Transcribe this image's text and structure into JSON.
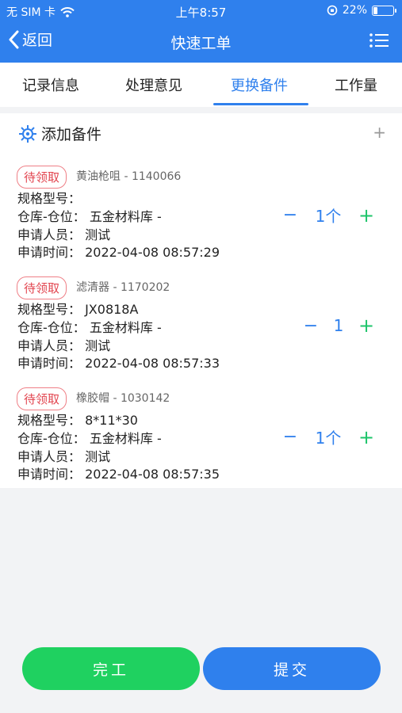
{
  "status_bar": {
    "carrier": "无 SIM 卡",
    "time": "上午8:57",
    "battery": "22%",
    "battery_level": 0.22
  },
  "nav": {
    "back_label": "返回",
    "title": "快速工单"
  },
  "tabs": [
    {
      "label": "记录信息",
      "active": false
    },
    {
      "label": "处理意见",
      "active": false
    },
    {
      "label": "更换备件",
      "active": true
    },
    {
      "label": "工作量",
      "active": false
    }
  ],
  "section": {
    "title": "添加备件",
    "add_symbol": "+"
  },
  "items": [
    {
      "status": "待领取",
      "title": "黄油枪咀 - 1140066",
      "spec": "规格型号：",
      "warehouse": "仓库-仓位：  五金材料库 -",
      "applicant": "申请人员：  测试",
      "time": "申请时间：  2022-04-08 08:57:29",
      "quantity": "1个"
    },
    {
      "status": "待领取",
      "title": "滤清器 - 1170202",
      "spec": "规格型号：  JX0818A",
      "warehouse": "仓库-仓位：  五金材料库 -",
      "applicant": "申请人员：  测试",
      "time": "申请时间：  2022-04-08 08:57:33",
      "quantity": "1"
    },
    {
      "status": "待领取",
      "title": "橡胶帽 - 1030142",
      "spec": "规格型号：  8*11*30",
      "warehouse": "仓库-仓位：  五金材料库 -",
      "applicant": "申请人员：  测试",
      "time": "申请时间：  2022-04-08 08:57:35",
      "quantity": "1个"
    }
  ],
  "qty_controls": {
    "minus": "−",
    "plus": "+"
  },
  "footer": {
    "finish_label": "完工",
    "submit_label": "提交"
  },
  "colors": {
    "primary": "#2f80ed",
    "green": "#1fd160",
    "badge_red": "#e2454f"
  }
}
